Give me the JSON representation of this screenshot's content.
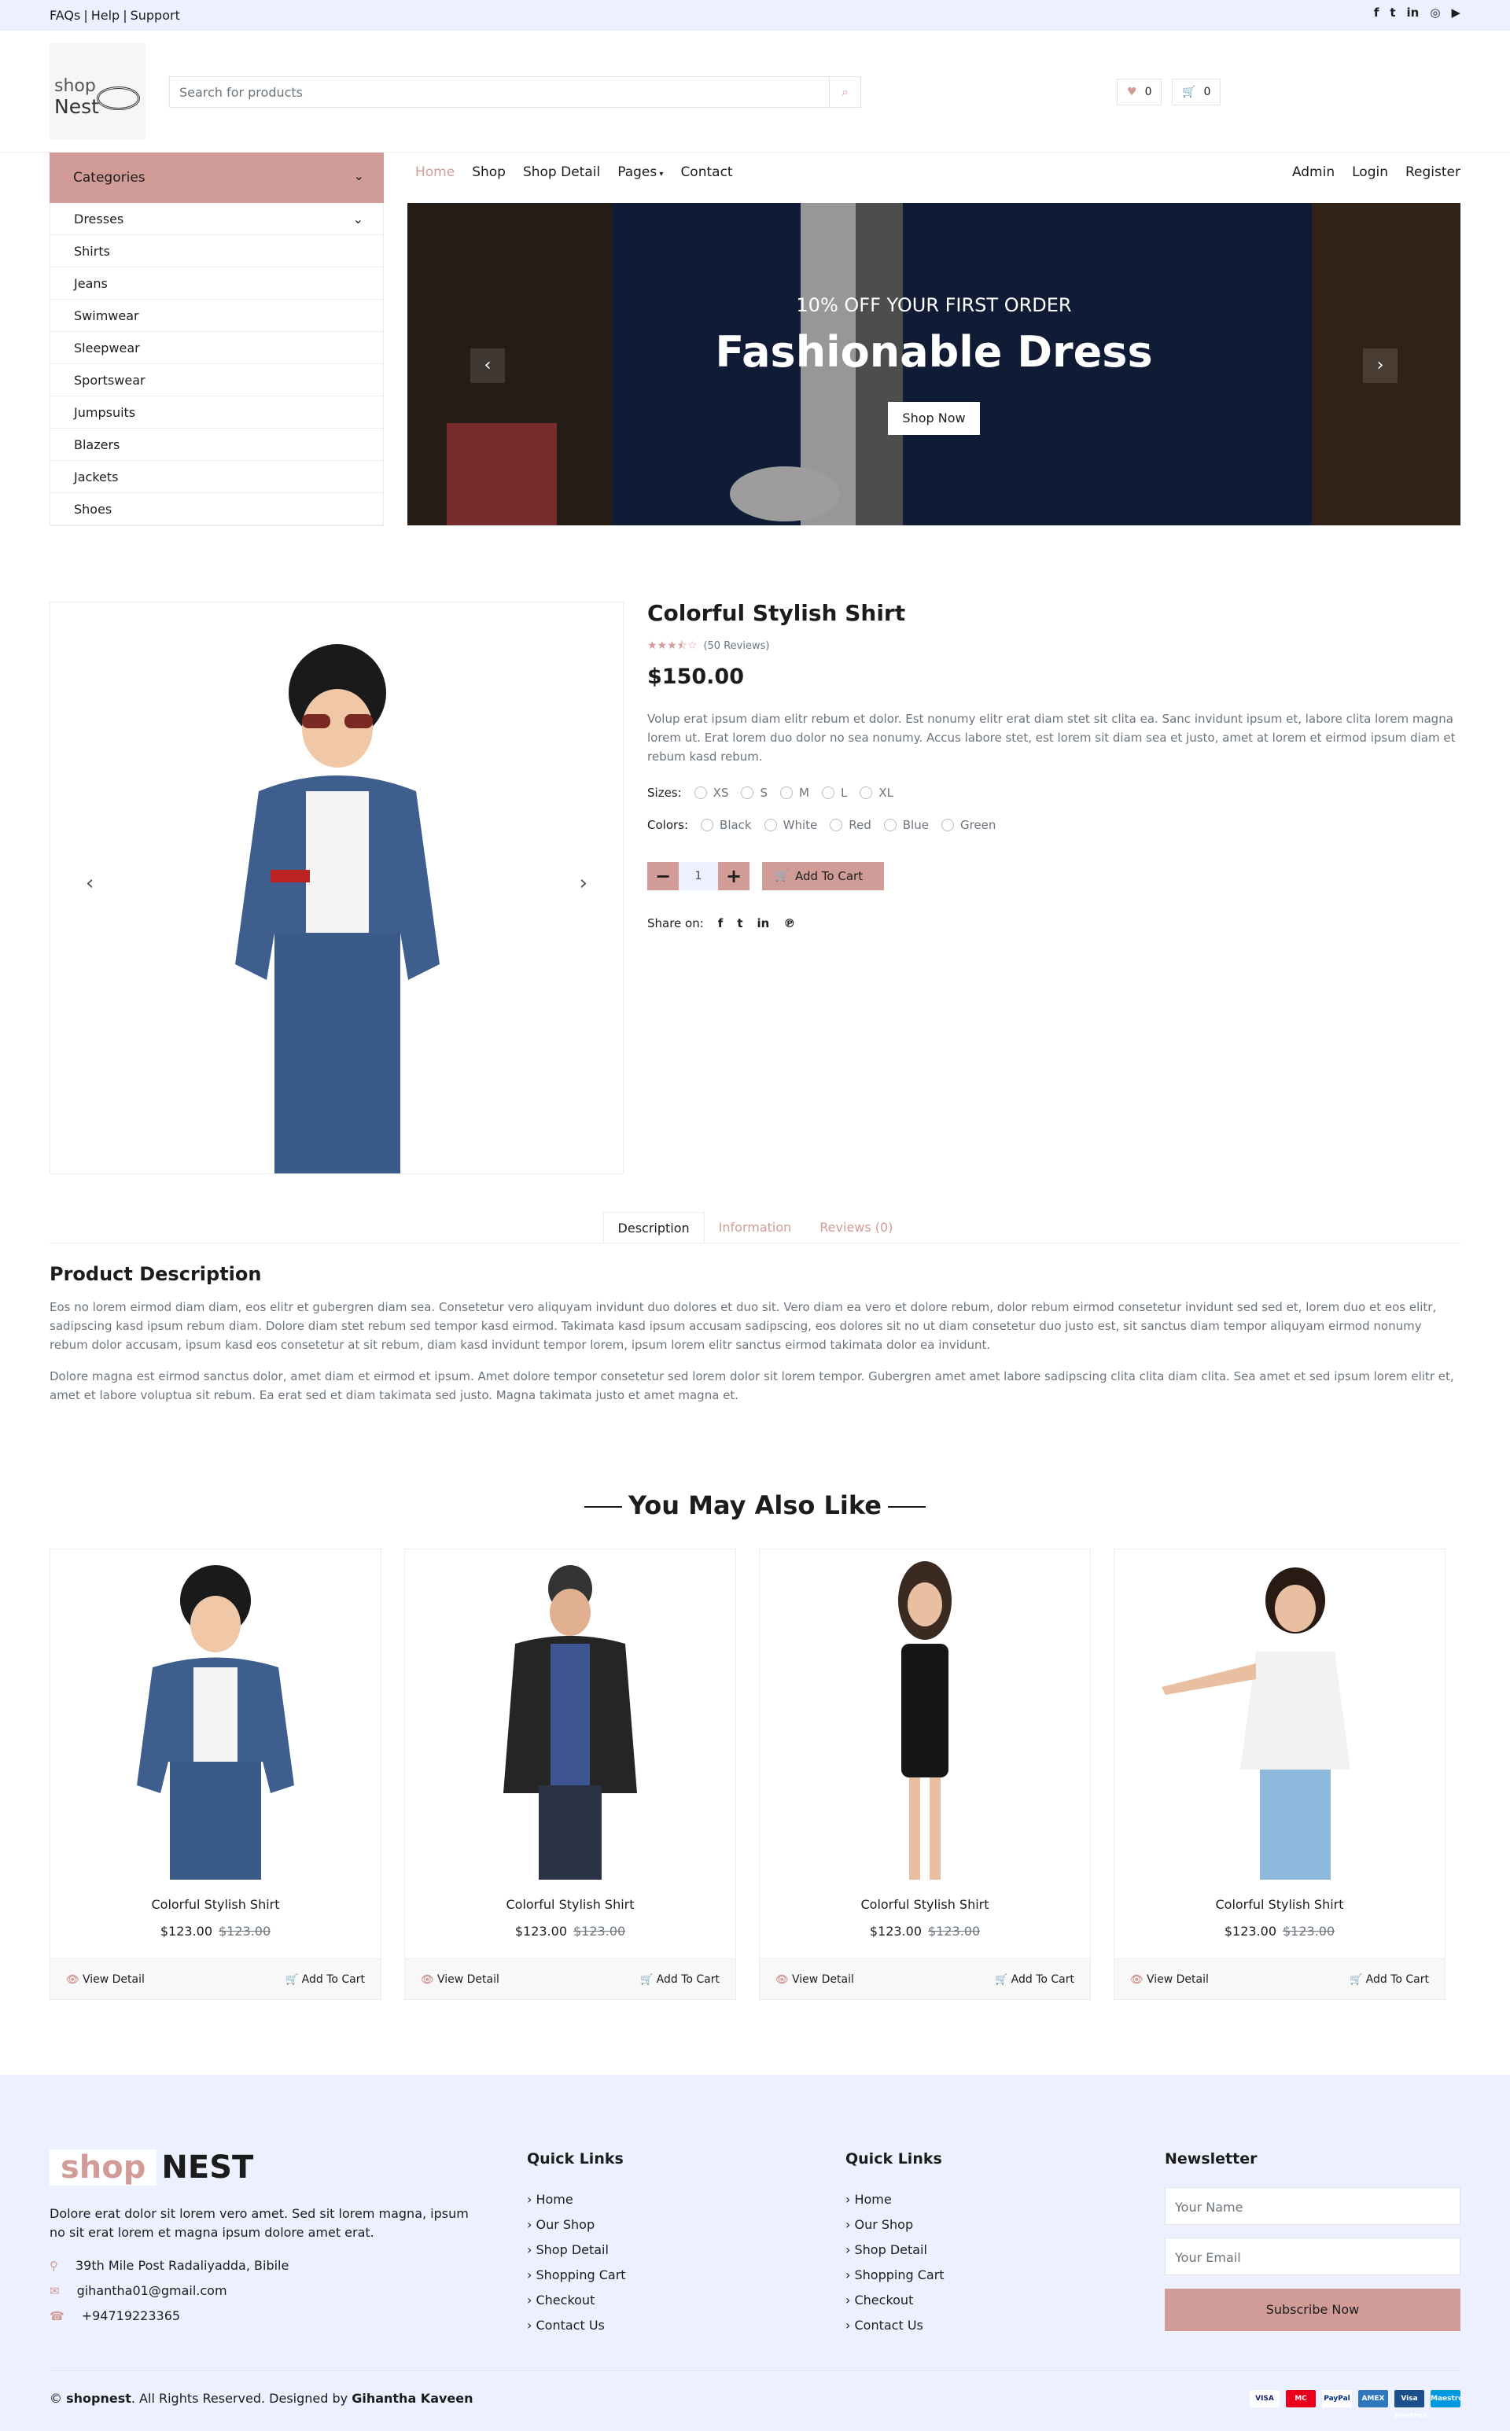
{
  "topbar": {
    "links": [
      "FAQs",
      "Help",
      "Support"
    ],
    "social": [
      "facebook-icon",
      "twitter-icon",
      "linkedin-icon",
      "instagram-icon",
      "youtube-icon"
    ]
  },
  "header": {
    "logo_top": "shop",
    "logo_bottom": "Nest",
    "search_placeholder": "Search for products",
    "wishlist_count": "0",
    "cart_count": "0"
  },
  "categories": {
    "label": "Categories",
    "items": [
      "Dresses",
      "Shirts",
      "Jeans",
      "Swimwear",
      "Sleepwear",
      "Sportswear",
      "Jumpsuits",
      "Blazers",
      "Jackets",
      "Shoes"
    ]
  },
  "nav": {
    "items": [
      "Home",
      "Shop",
      "Shop Detail",
      "Pages",
      "Contact"
    ],
    "right": [
      "Admin",
      "Login",
      "Register"
    ]
  },
  "hero": {
    "subtitle": "10% OFF YOUR FIRST ORDER",
    "title": "Fashionable Dress",
    "button": "Shop Now"
  },
  "product": {
    "title": "Colorful Stylish Shirt",
    "rating": 3.5,
    "reviews": "(50 Reviews)",
    "price": "$150.00",
    "description": "Volup erat ipsum diam elitr rebum et dolor. Est nonumy elitr erat diam stet sit clita ea. Sanc invidunt ipsum et, labore clita lorem magna lorem ut. Erat lorem duo dolor no sea nonumy. Accus labore stet, est lorem sit diam sea et justo, amet at lorem et eirmod ipsum diam et rebum kasd rebum.",
    "sizes_label": "Sizes:",
    "sizes": [
      "XS",
      "S",
      "M",
      "L",
      "XL"
    ],
    "colors_label": "Colors:",
    "colors": [
      "Black",
      "White",
      "Red",
      "Blue",
      "Green"
    ],
    "quantity": "1",
    "add_to_cart": "Add To Cart",
    "share_label": "Share on:"
  },
  "tabs": {
    "items": [
      "Description",
      "Information",
      "Reviews (0)"
    ],
    "active": "Description"
  },
  "description_section": {
    "heading": "Product Description",
    "p1": "Eos no lorem eirmod diam diam, eos elitr et gubergren diam sea. Consetetur vero aliquyam invidunt duo dolores et duo sit. Vero diam ea vero et dolore rebum, dolor rebum eirmod consetetur invidunt sed sed et, lorem duo et eos elitr, sadipscing kasd ipsum rebum diam. Dolore diam stet rebum sed tempor kasd eirmod. Takimata kasd ipsum accusam sadipscing, eos dolores sit no ut diam consetetur duo justo est, sit sanctus diam tempor aliquyam eirmod nonumy rebum dolor accusam, ipsum kasd eos consetetur at sit rebum, diam kasd invidunt tempor lorem, ipsum lorem elitr sanctus eirmod takimata dolor ea invidunt.",
    "p2": "Dolore magna est eirmod sanctus dolor, amet diam et eirmod et ipsum. Amet dolore tempor consetetur sed lorem dolor sit lorem tempor. Gubergren amet amet labore sadipscing clita clita diam clita. Sea amet et sed ipsum lorem elitr et, amet et labore voluptua sit rebum. Ea erat sed et diam takimata sed justo. Magna takimata justo et amet magna et."
  },
  "related": {
    "heading": "You May Also Like",
    "items": [
      {
        "name": "Colorful Stylish Shirt",
        "price": "$123.00",
        "old_price": "$123.00"
      },
      {
        "name": "Colorful Stylish Shirt",
        "price": "$123.00",
        "old_price": "$123.00"
      },
      {
        "name": "Colorful Stylish Shirt",
        "price": "$123.00",
        "old_price": "$123.00"
      },
      {
        "name": "Colorful Stylish Shirt",
        "price": "$123.00",
        "old_price": "$123.00"
      }
    ],
    "view_label": "View Detail",
    "cart_label": "Add To Cart"
  },
  "footer": {
    "logo_a": "shop",
    "logo_b": "NEST",
    "about": "Dolore erat dolor sit lorem vero amet. Sed sit lorem magna, ipsum no sit erat lorem et magna ipsum dolore amet erat.",
    "address": "39th Mile Post Radaliyadda, Bibile",
    "email": "gihantha01@gmail.com",
    "phone": "+94719223365",
    "col1_title": "Quick Links",
    "col2_title": "Quick Links",
    "links": [
      "Home",
      "Our Shop",
      "Shop Detail",
      "Shopping Cart",
      "Checkout",
      "Contact Us"
    ],
    "newsletter_title": "Newsletter",
    "name_placeholder": "Your Name",
    "email_placeholder": "Your Email",
    "subscribe": "Subscribe Now",
    "copy_prefix": "© ",
    "copy_brand": "shopnest",
    "copy_mid": ". All Rights Reserved. Designed by ",
    "copy_author": "Gihantha Kaveen",
    "payments": [
      "VISA",
      "MC",
      "PayPal",
      "AMEX",
      "Visa Electron",
      "Maestro"
    ]
  },
  "colors": {
    "accent": "#d19c97",
    "light_bg": "#edf1ff",
    "text": "#1c1c1c"
  }
}
